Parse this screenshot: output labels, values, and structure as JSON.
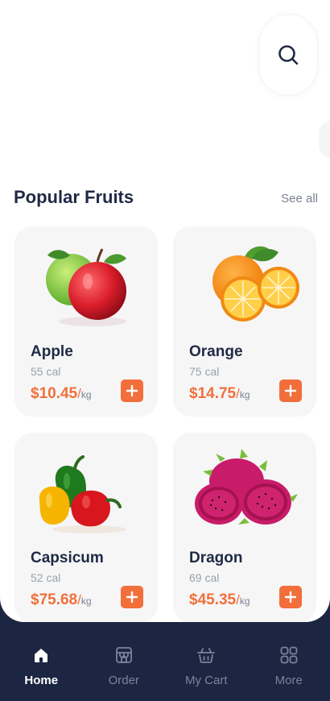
{
  "header": {
    "search_icon": "search-icon"
  },
  "section": {
    "title": "Popular Fruits",
    "see_all": "See all"
  },
  "fruits": [
    {
      "name": "Apple",
      "calories": "55 cal",
      "price": "$10.45",
      "unit": "kg",
      "image": "apple"
    },
    {
      "name": "Orange",
      "calories": "75 cal",
      "price": "$14.75",
      "unit": "kg",
      "image": "orange"
    },
    {
      "name": "Capsicum",
      "calories": "52 cal",
      "price": "$75.68",
      "unit": "kg",
      "image": "capsicum"
    },
    {
      "name": "Dragon",
      "calories": "69 cal",
      "price": "$45.35",
      "unit": "kg",
      "image": "dragon-fruit"
    }
  ],
  "tabs": [
    {
      "label": "Home",
      "icon": "home-icon",
      "active": true
    },
    {
      "label": "Order",
      "icon": "store-icon",
      "active": false
    },
    {
      "label": "My Cart",
      "icon": "basket-icon",
      "active": false
    },
    {
      "label": "More",
      "icon": "grid-icon",
      "active": false
    }
  ],
  "colors": {
    "accent": "#f26e3a",
    "nav_background": "#1c2541",
    "title_text": "#1f2a44",
    "card_background": "#f6f6f7"
  }
}
